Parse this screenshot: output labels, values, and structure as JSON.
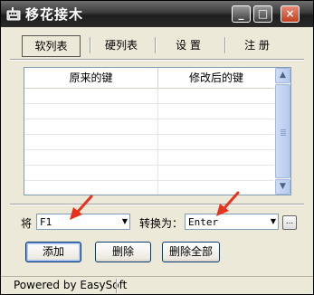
{
  "window": {
    "title": "移花接木"
  },
  "caption_buttons": {
    "minimize": "_",
    "maximize": "□",
    "close": "×"
  },
  "tabs": [
    {
      "label": "软列表",
      "selected": true
    },
    {
      "label": "硬列表",
      "selected": false
    },
    {
      "label": "设 置",
      "selected": false
    },
    {
      "label": "注 册",
      "selected": false
    }
  ],
  "list": {
    "columns": [
      "原来的键",
      "修改后的键"
    ],
    "rows": []
  },
  "mapping": {
    "from_label": "将",
    "from_value": "F1",
    "to_label": "转换为：",
    "to_value": "Enter",
    "browse_label": "..."
  },
  "buttons": {
    "add": "添加",
    "delete": "删除",
    "delete_all": "删除全部"
  },
  "status": {
    "text": "Powered by EasySoft"
  },
  "colors": {
    "accent_arrow": "#e8321e",
    "list_border": "#7f9db9"
  }
}
